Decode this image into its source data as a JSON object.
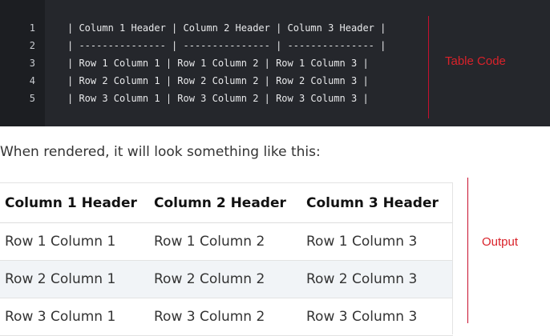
{
  "code": {
    "line_numbers": [
      "1",
      "2",
      "3",
      "4",
      "5"
    ],
    "lines": [
      "| Column 1 Header | Column 2 Header | Column 3 Header |",
      "| --------------- | --------------- | --------------- |",
      "| Row 1 Column 1 | Row 1 Column 2 | Row 1 Column 3 |",
      "| Row 2 Column 1 | Row 2 Column 2 | Row 2 Column 3 |",
      "| Row 3 Column 1 | Row 3 Column 2 | Row 3 Column 3 |"
    ]
  },
  "annotations": {
    "code_label": "Table Code",
    "output_label": "Output",
    "color": "#d9222a"
  },
  "intro_text": "When rendered, it will look something like this:",
  "table": {
    "headers": [
      "Column 1 Header",
      "Column 2 Header",
      "Column 3 Header"
    ],
    "rows": [
      [
        "Row 1 Column 1",
        "Row 1 Column 2",
        "Row 1 Column 3"
      ],
      [
        "Row 2 Column 1",
        "Row 2 Column 2",
        "Row 2 Column 3"
      ],
      [
        "Row 3 Column 1",
        "Row 3 Column 2",
        "Row 3 Column 3"
      ]
    ]
  }
}
